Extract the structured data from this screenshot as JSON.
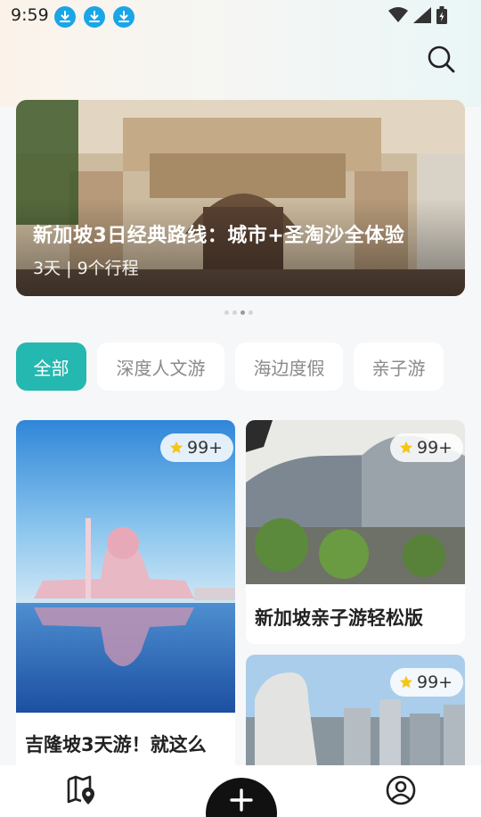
{
  "status_bar": {
    "time": "9:59"
  },
  "banner": {
    "title": "新加坡3日经典路线：城市+圣淘沙全体验",
    "subtitle": "3天 | 9个行程"
  },
  "tabs": [
    {
      "label": "全部",
      "active": true
    },
    {
      "label": "深度人文游",
      "active": false
    },
    {
      "label": "海边度假",
      "active": false
    },
    {
      "label": "亲子游",
      "active": false
    }
  ],
  "cards": [
    {
      "title": "吉隆坡3天游！就这么",
      "rating": "99+"
    },
    {
      "title": "新加坡亲子游轻松版",
      "rating": "99+"
    },
    {
      "title": "",
      "rating": "99+"
    }
  ],
  "colors": {
    "accent": "#25b8b0",
    "star": "#f5c518",
    "download": "#1aa6e6"
  },
  "carousel": {
    "count": 4,
    "active_index": 2
  }
}
